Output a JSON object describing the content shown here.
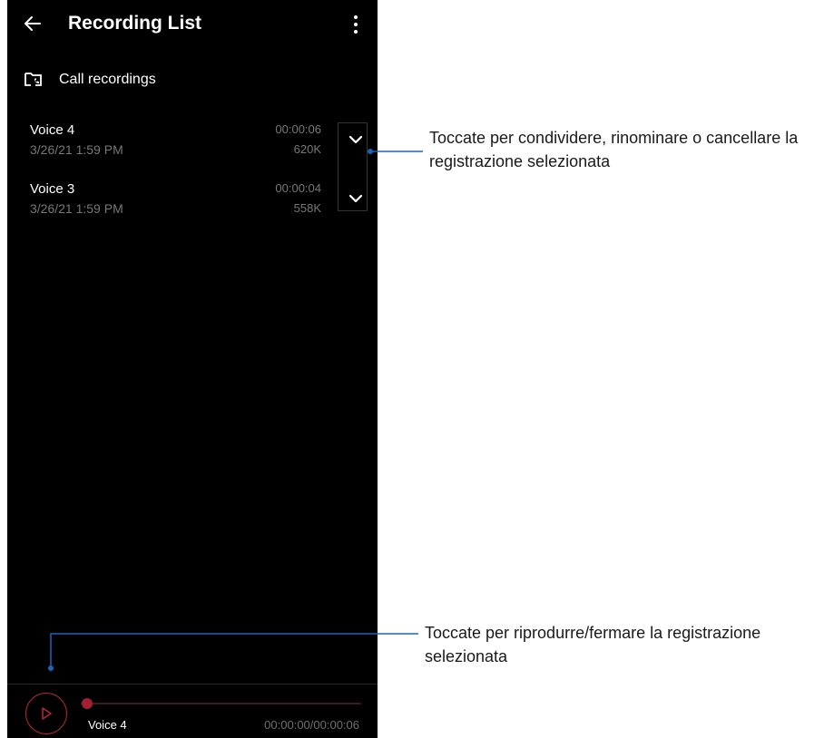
{
  "header": {
    "title": "Recording List",
    "back_icon": "arrow-left-icon",
    "menu_icon": "more-vertical-icon"
  },
  "folder": {
    "label": "Call recordings",
    "icon": "folder-call-icon"
  },
  "recordings": [
    {
      "name": "Voice 4",
      "date": "3/26/21 1:59 PM",
      "duration": "00:00:06",
      "size": "620K"
    },
    {
      "name": "Voice 3",
      "date": "3/26/21 1:59 PM",
      "duration": "00:00:04",
      "size": "558K"
    }
  ],
  "player": {
    "track_name": "Voice 4",
    "time": "00:00:00/00:00:06",
    "progress": 0,
    "play_icon": "play-icon"
  },
  "callouts": [
    {
      "line1": "Toccate per condividere, rinominare o cancellare la",
      "line2": "registrazione selezionata"
    },
    {
      "line1": "Toccate per riprodurre/fermare la registrazione",
      "line2": "selezionata"
    }
  ],
  "colors": {
    "background": "#000000",
    "accent": "#b0263a",
    "secondary_text": "#777777",
    "callout_line": "#1f63b5"
  }
}
